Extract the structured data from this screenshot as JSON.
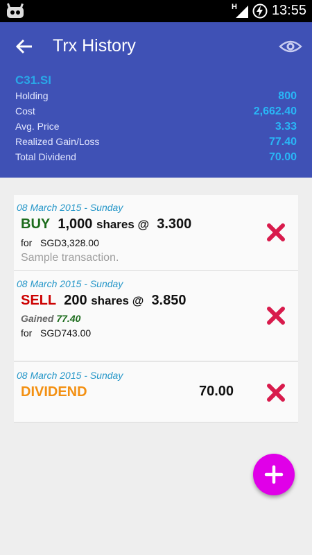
{
  "status": {
    "network": "H",
    "time": "13:55"
  },
  "header": {
    "title": "Trx History"
  },
  "summary": {
    "symbol": "C31.SI",
    "rows": [
      {
        "label": "Holding",
        "value": "800"
      },
      {
        "label": "Cost",
        "value": "2,662.40"
      },
      {
        "label": "Avg. Price",
        "value": "3.33"
      },
      {
        "label": "Realized Gain/Loss",
        "value": "77.40"
      },
      {
        "label": "Total Dividend",
        "value": "70.00"
      }
    ]
  },
  "transactions": [
    {
      "date": "08 March 2015 - Sunday",
      "action": "BUY",
      "action_color": "#1b6b1b",
      "qty": "1,000",
      "shares_text": "shares @",
      "price": "3.300",
      "for_label": "for",
      "amount": "SGD3,328.00",
      "note": "Sample transaction."
    },
    {
      "date": "08 March 2015 - Sunday",
      "action": "SELL",
      "action_color": "#cc0000",
      "qty": "200",
      "shares_text": "shares @",
      "price": "3.850",
      "gain_label": "Gained",
      "gain_value": "77.40",
      "for_label": "for",
      "amount": "SGD743.00"
    },
    {
      "date": "08 March 2015 - Sunday",
      "action": "DIVIDEND",
      "action_color": "#f39012",
      "amount": "70.00"
    }
  ],
  "colors": {
    "appbar": "#3f51b5",
    "accent_fab": "#e000e8",
    "delete": "#d81b4c"
  }
}
